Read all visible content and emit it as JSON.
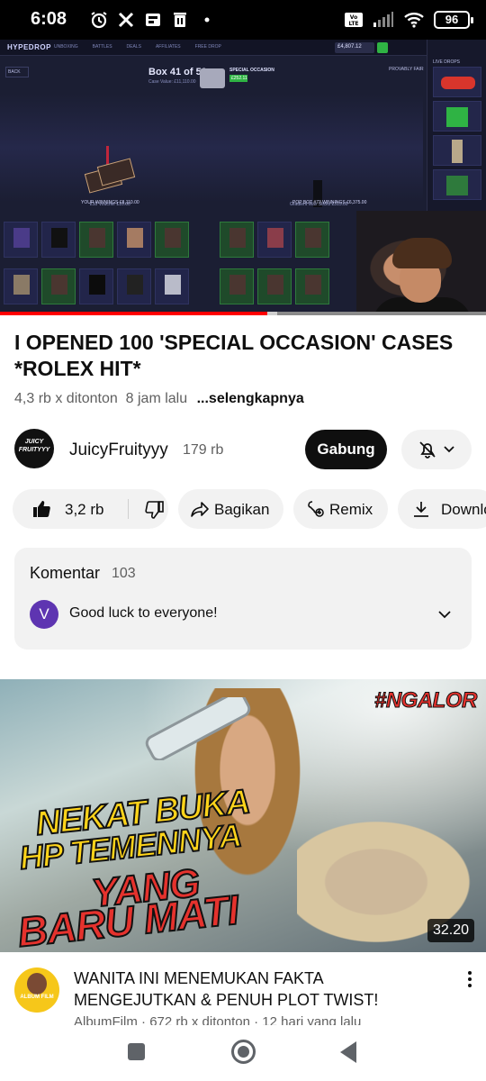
{
  "status_bar": {
    "time": "6:08",
    "left_icons": [
      "alarm-icon",
      "x-icon",
      "app-icon",
      "trash-icon",
      "dot-icon"
    ],
    "right_icons": [
      "volte-icon",
      "signal-icon",
      "wifi-icon"
    ],
    "battery": "96"
  },
  "player": {
    "game": {
      "logo": "HYPEDROP",
      "nav": [
        "UNBOXING",
        "BATTLES",
        "DEALS",
        "AFFILIATES",
        "FREE DROP"
      ],
      "balance": "£4,807.12",
      "back": "BACK",
      "box_title": "Box 41 of 50",
      "box_sub": "Case Value: £11,110.00",
      "case_name": "SPECIAL OCCASION",
      "case_price": "£252.11",
      "provably_fair": "PROVABLY FAIR",
      "your_winnings": "YOUR WINNINGS £8,110.00",
      "pop_bot": "POP BOT #73 WINNINGS £6,375.00",
      "reel_label_1": "£10 Voucher £10.00",
      "reel_label_2": "Gradient Wax Sticks £315.00",
      "live_drops": "LIVE DROPS"
    },
    "progress_percent": 55,
    "buffer_percent": 2
  },
  "video": {
    "title": "I OPENED 100 'SPECIAL OCCASION' CASES *ROLEX HIT*",
    "views": "4,3 rb x ditonton",
    "age": "8 jam lalu",
    "more": "...selengkapnya"
  },
  "channel": {
    "name": "JuicyFruityyy",
    "avatar_text": "JUICY FRUITYYY",
    "subscribers": "179 rb",
    "join_label": "Gabung",
    "bell_icon": "bell-off-icon"
  },
  "actions": {
    "like_count": "3,2 rb",
    "share_label": "Bagikan",
    "remix_label": "Remix",
    "download_label": "Download"
  },
  "comments": {
    "title": "Komentar",
    "count": "103",
    "avatar_letter": "V",
    "avatar_color": "#5e35b1",
    "top_comment": "Good luck to everyone!"
  },
  "next_video": {
    "tag": "#NGALOR",
    "thumb_lines": [
      "NEKAT BUKA",
      "HP TEMENNYA",
      "YANG",
      "BARU MATI"
    ],
    "duration": "32.20",
    "title": "WANITA INI MENEMUKAN FAKTA MENGEJUTKAN & PENUH PLOT TWIST!",
    "channel": "AlbumFilm",
    "views": "672 rb x ditonton",
    "age": "12 hari yang lalu",
    "avatar_text": "ALBUM FILM"
  },
  "colors": {
    "accent_red": "#ff0000",
    "pill_bg": "#f2f2f2",
    "text_primary": "#0f0f0f",
    "text_secondary": "#606060"
  }
}
